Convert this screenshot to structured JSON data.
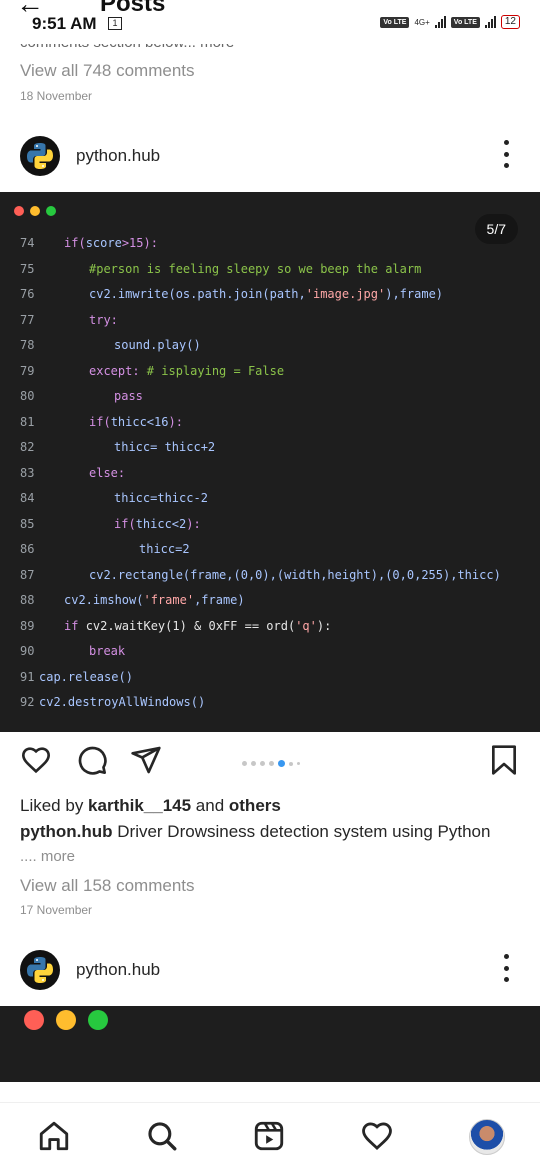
{
  "status_bar": {
    "time": "9:51 AM",
    "notification_count": "1",
    "network_label": "4G+",
    "sim_tag": "Vo LTE",
    "battery": "12"
  },
  "header": {
    "title": "Posts"
  },
  "post1": {
    "caption_cut": "comments section below... more",
    "view_comments": "View all 748 comments",
    "date": "18 November"
  },
  "post2": {
    "author": "python.hub",
    "image_counter": "5/7",
    "code_lines": [
      {
        "n": "74",
        "indent": 1,
        "parts": [
          {
            "t": "if(",
            "c": "kw"
          },
          {
            "t": "score",
            "c": "fn"
          },
          {
            "t": ">15):",
            "c": "kw"
          }
        ]
      },
      {
        "n": "75",
        "indent": 2,
        "parts": [
          {
            "t": "#person is feeling sleepy so we beep the alarm",
            "c": "cm"
          }
        ]
      },
      {
        "n": "76",
        "indent": 2,
        "parts": [
          {
            "t": "cv2.imwrite(os.path.join(path,",
            "c": "fn"
          },
          {
            "t": "'image.jpg'",
            "c": "str"
          },
          {
            "t": "),frame)",
            "c": "fn"
          }
        ]
      },
      {
        "n": "77",
        "indent": 2,
        "parts": [
          {
            "t": "try:",
            "c": "kw"
          }
        ]
      },
      {
        "n": "78",
        "indent": 3,
        "parts": [
          {
            "t": "sound.play()",
            "c": "fn"
          }
        ]
      },
      {
        "n": "79",
        "indent": 2,
        "parts": [
          {
            "t": "except: ",
            "c": "kw"
          },
          {
            "t": "# isplaying = False",
            "c": "cm"
          }
        ]
      },
      {
        "n": "80",
        "indent": 3,
        "parts": [
          {
            "t": "pass",
            "c": "kw"
          }
        ]
      },
      {
        "n": "81",
        "indent": 2,
        "parts": [
          {
            "t": "if(",
            "c": "kw"
          },
          {
            "t": "thicc<16",
            "c": "fn"
          },
          {
            "t": "):",
            "c": "kw"
          }
        ]
      },
      {
        "n": "82",
        "indent": 3,
        "parts": [
          {
            "t": "thicc= thicc+2",
            "c": "fn"
          }
        ]
      },
      {
        "n": "83",
        "indent": 2,
        "parts": [
          {
            "t": "else:",
            "c": "kw"
          }
        ]
      },
      {
        "n": "84",
        "indent": 3,
        "parts": [
          {
            "t": "thicc=thicc-2",
            "c": "fn"
          }
        ]
      },
      {
        "n": "85",
        "indent": 3,
        "parts": [
          {
            "t": "if(",
            "c": "kw"
          },
          {
            "t": "thicc<2",
            "c": "fn"
          },
          {
            "t": "):",
            "c": "kw"
          }
        ]
      },
      {
        "n": "86",
        "indent": 4,
        "parts": [
          {
            "t": "thicc=2",
            "c": "fn"
          }
        ]
      },
      {
        "n": "87",
        "indent": 2,
        "parts": [
          {
            "t": "cv2.rectangle(frame,(0,0),(width,height),(0,0,255),thicc)",
            "c": "fn"
          }
        ]
      },
      {
        "n": "88",
        "indent": 1,
        "parts": [
          {
            "t": "cv2.imshow(",
            "c": "fn"
          },
          {
            "t": "'frame'",
            "c": "str"
          },
          {
            "t": ",frame)",
            "c": "fn"
          }
        ]
      },
      {
        "n": "89",
        "indent": 1,
        "parts": [
          {
            "t": "if ",
            "c": "kw"
          },
          {
            "t": "cv2.waitKey(1) & 0xFF == ord(",
            "c": "tx"
          },
          {
            "t": "'q'",
            "c": "str"
          },
          {
            "t": "):",
            "c": "tx"
          }
        ]
      },
      {
        "n": "90",
        "indent": 2,
        "parts": [
          {
            "t": "break",
            "c": "kw"
          }
        ]
      },
      {
        "n": "91",
        "indent": 0,
        "parts": [
          {
            "t": "cap.release()",
            "c": "fn"
          }
        ]
      },
      {
        "n": "92",
        "indent": 0,
        "parts": [
          {
            "t": "cv2.destroyAllWindows()",
            "c": "fn"
          }
        ]
      }
    ],
    "liked_by_prefix": "Liked by ",
    "liked_by_user": "karthik__145",
    "liked_by_and": " and ",
    "liked_by_others": "others",
    "caption_author": "python.hub",
    "caption_text": " Driver Drowsiness detection system using Python",
    "caption_more": ".... more",
    "view_comments": "View all 158 comments",
    "date": "17 November"
  },
  "post3": {
    "author": "python.hub"
  },
  "colors": {
    "mac_red": "#ff5f56",
    "mac_yellow": "#ffbd2e",
    "mac_green": "#27c93f",
    "carousel_active": "#3897f0"
  },
  "bottom_nav": [
    "home-icon",
    "search-icon",
    "reels-icon",
    "heart-icon",
    "profile-avatar"
  ]
}
